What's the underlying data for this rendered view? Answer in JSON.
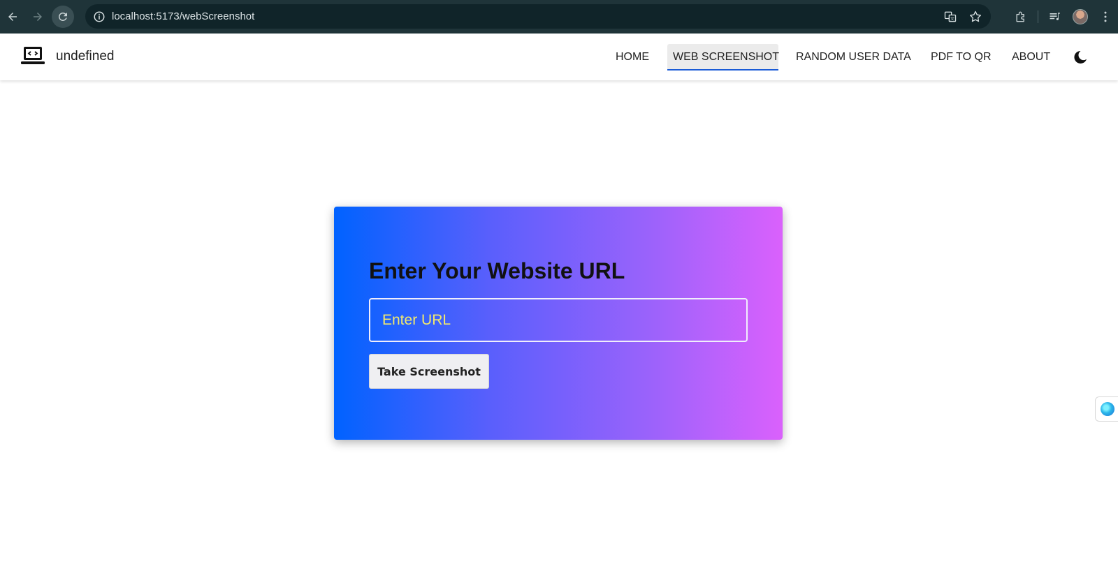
{
  "browser": {
    "url": "localhost:5173/webScreenshot"
  },
  "app": {
    "brand": "undefined",
    "nav": [
      {
        "label": "HOME",
        "active": false
      },
      {
        "label": "WEB SCREENSHOT",
        "active": true
      },
      {
        "label": "RANDOM USER DATA",
        "active": false
      },
      {
        "label": "PDF TO QR",
        "active": false
      },
      {
        "label": "ABOUT",
        "active": false
      }
    ],
    "theme_icon": "moon-icon"
  },
  "card": {
    "title": "Enter Your Website URL",
    "input_placeholder": "Enter URL",
    "input_value": "",
    "button_label": "Take Screenshot"
  },
  "colors": {
    "chrome_bg": "#1f3439",
    "active_nav_underline": "#1a5bd6",
    "card_gradient_start": "#0062ff",
    "card_gradient_end": "#da61fc",
    "placeholder": "#f2e96e"
  }
}
